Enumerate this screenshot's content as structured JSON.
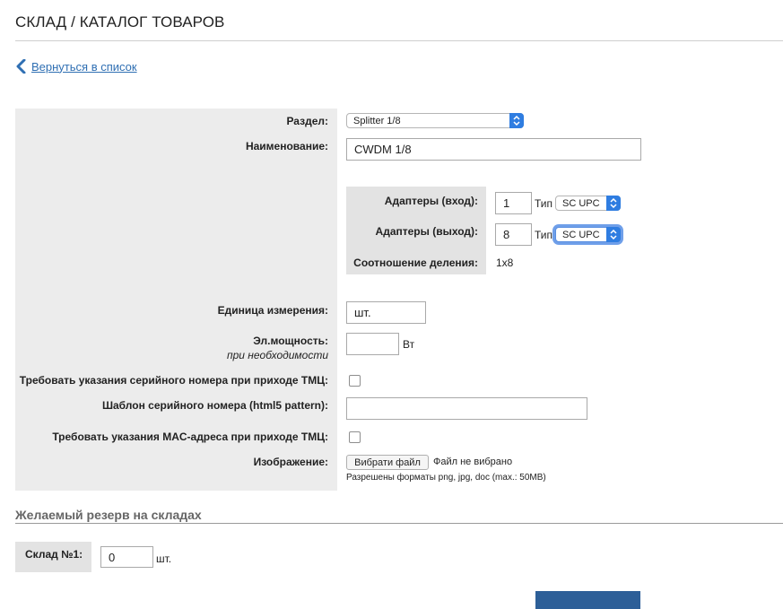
{
  "header": {
    "title": "СКЛАД / КАТАЛОГ ТОВАРОВ"
  },
  "nav": {
    "back_label": "Вернуться в список"
  },
  "form": {
    "section_label": "Раздел:",
    "section_value": "Splitter 1/8",
    "name_label": "Наименование:",
    "name_value": "CWDM 1/8",
    "adapters_in_label": "Адаптеры (вход):",
    "adapters_in_value": "1",
    "adapters_in_type_label": "Тип",
    "adapters_in_type_value": "SC UPC",
    "adapters_out_label": "Адаптеры (выход):",
    "adapters_out_value": "8",
    "adapters_out_type_label": "Тип",
    "adapters_out_type_value": "SC UPC",
    "ratio_label": "Соотношение деления:",
    "ratio_value": "1x8",
    "unit_label": "Единица измерения:",
    "unit_value": "шт.",
    "power_label": "Эл.мощность:",
    "power_hint": "при необходимости",
    "power_value": "",
    "power_unit": "Вт",
    "require_serial_label": "Требовать указания серийного номера при приходе ТМЦ:",
    "serial_pattern_label": "Шаблон серийного номера (html5 pattern):",
    "serial_pattern_value": "",
    "require_mac_label": "Требовать указания MAC-адреса при приходе ТМЦ:",
    "image_label": "Изображение:",
    "file_button_label": "Вибрати файл",
    "file_status": "Файл не вибрано",
    "file_hint": "Разрешены форматы png, jpg, doc (max.: 50MB)"
  },
  "reserve": {
    "title": "Желаемый резерв на складах",
    "stock_label": "Склад №1:",
    "stock_value": "0",
    "stock_unit": "шт."
  },
  "colors": {
    "accent": "#2f7de1",
    "link": "#2f6fb3",
    "button": "#2d5f98"
  },
  "icons": [
    "chevron-left-icon",
    "select-arrows-icon"
  ]
}
